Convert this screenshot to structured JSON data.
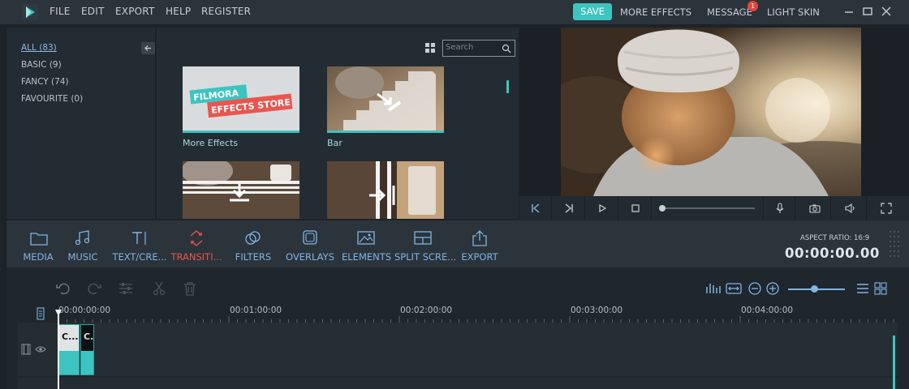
{
  "app": {
    "menu": [
      "FILE",
      "EDIT",
      "EXPORT",
      "HELP",
      "REGISTER"
    ],
    "save_label": "SAVE",
    "more_effects_label": "MORE EFFECTS",
    "message_label": "MESSAGE",
    "message_badge": "1",
    "light_skin_label": "LIGHT SKIN"
  },
  "categories": [
    {
      "label": "ALL (83)",
      "active": true
    },
    {
      "label": "BASIC (9)",
      "active": false
    },
    {
      "label": "FANCY (74)",
      "active": false
    },
    {
      "label": "FAVOURITE (0)",
      "active": false
    }
  ],
  "library": {
    "search_placeholder": "Search",
    "store_banner_line1": "FILMORA",
    "store_banner_line2": "EFFECTS STORE",
    "items": [
      {
        "label": "More Effects"
      },
      {
        "label": "Bar"
      },
      {
        "label": ""
      },
      {
        "label": ""
      }
    ]
  },
  "toolbar": {
    "tools": [
      {
        "label": "MEDIA",
        "icon": "folder-icon"
      },
      {
        "label": "MUSIC",
        "icon": "music-icon"
      },
      {
        "label": "TEXT/CRE...",
        "icon": "text-icon"
      },
      {
        "label": "TRANSITI...",
        "icon": "transition-icon",
        "active": true
      },
      {
        "label": "FILTERS",
        "icon": "filters-icon"
      },
      {
        "label": "OVERLAYS",
        "icon": "overlays-icon"
      },
      {
        "label": "ELEMENTS",
        "icon": "elements-icon"
      },
      {
        "label": "SPLIT SCRE...",
        "icon": "split-screen-icon"
      },
      {
        "label": "EXPORT",
        "icon": "export-icon"
      }
    ],
    "aspect_ratio": "ASPECT RATIO: 16:9",
    "timecode": "00:00:00.00"
  },
  "timeline": {
    "ruler": [
      "00:00:00:00",
      "00:01:00:00",
      "00:02:00:00",
      "00:03:00:00",
      "00:04:00:00"
    ],
    "clips": [
      {
        "label": "C..."
      },
      {
        "label": "C."
      }
    ]
  },
  "colors": {
    "accent": "#3ec4c0",
    "active_tool": "#e8564f",
    "tool_label": "#7fb6e3",
    "background": "#1c2329",
    "badge": "#e8453c"
  }
}
